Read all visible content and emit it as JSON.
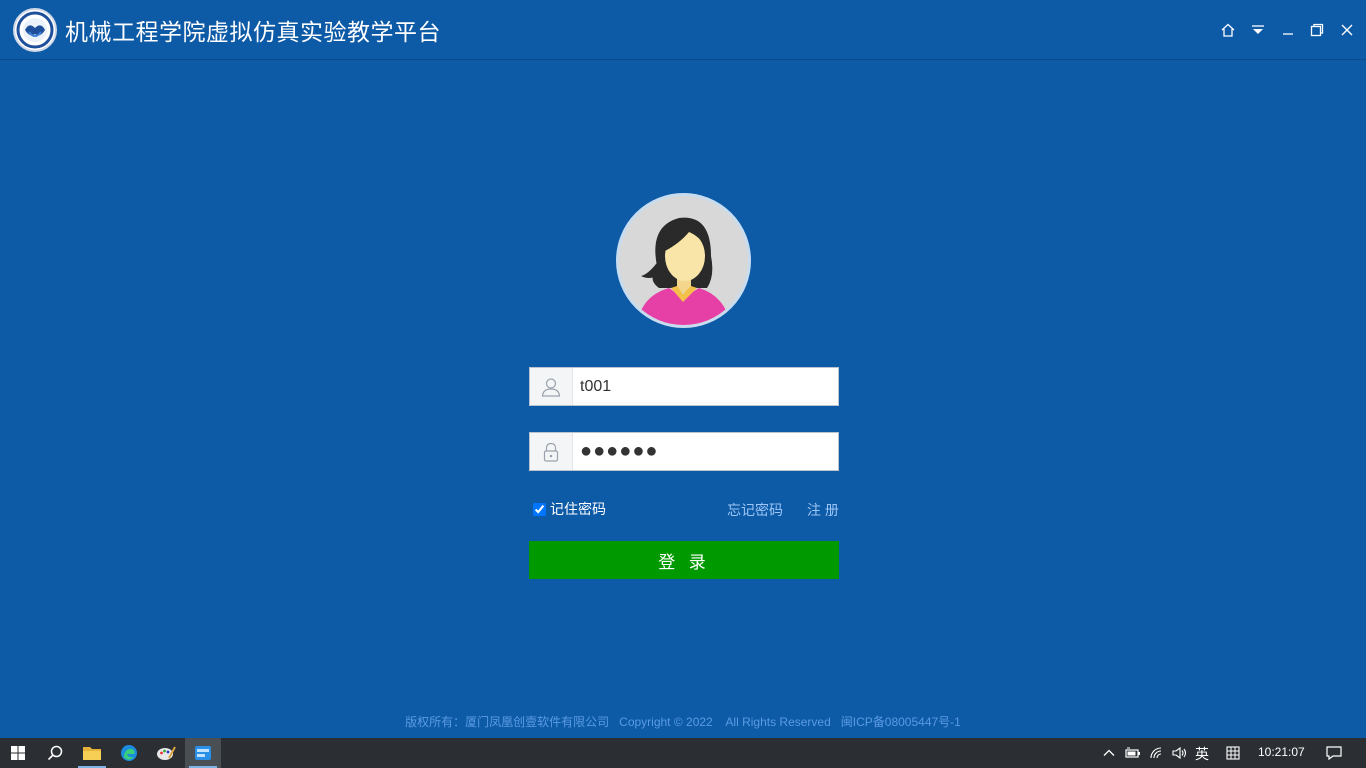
{
  "app": {
    "title": "机械工程学院虚拟仿真实验教学平台"
  },
  "login": {
    "username_value": "t001",
    "password_mask": "●●●●●●",
    "remember_label": "记住密码",
    "remember_checked": true,
    "forgot_label": "忘记密码",
    "register_label": "注 册",
    "login_label": "登 录"
  },
  "footer": {
    "text": "版权所有：厦门凤凰创壹软件有限公司   Copyright © 2022    All Rights Reserved   闽ICP备08005447号-1"
  },
  "taskbar": {
    "lang": "英",
    "time": "10:21:07"
  },
  "colors": {
    "background": "#0d5aa7",
    "login_button": "#009a00",
    "link": "#9dc6f5",
    "footer_text": "#5a9be2",
    "taskbar": "#2b2f33"
  },
  "icons": {
    "window_controls": [
      "home-icon",
      "dropdown-icon",
      "minimize-icon",
      "maximize-icon",
      "close-icon"
    ],
    "fields": [
      "user-icon",
      "lock-icon"
    ],
    "taskbar": [
      "windows-start-icon",
      "search-icon",
      "file-explorer-icon",
      "edge-icon",
      "paint-icon",
      "app-icon"
    ],
    "tray": [
      "chevron-up-icon",
      "battery-icon",
      "wifi-icon",
      "volume-icon",
      "keyboard-grid-icon",
      "notification-icon"
    ]
  }
}
